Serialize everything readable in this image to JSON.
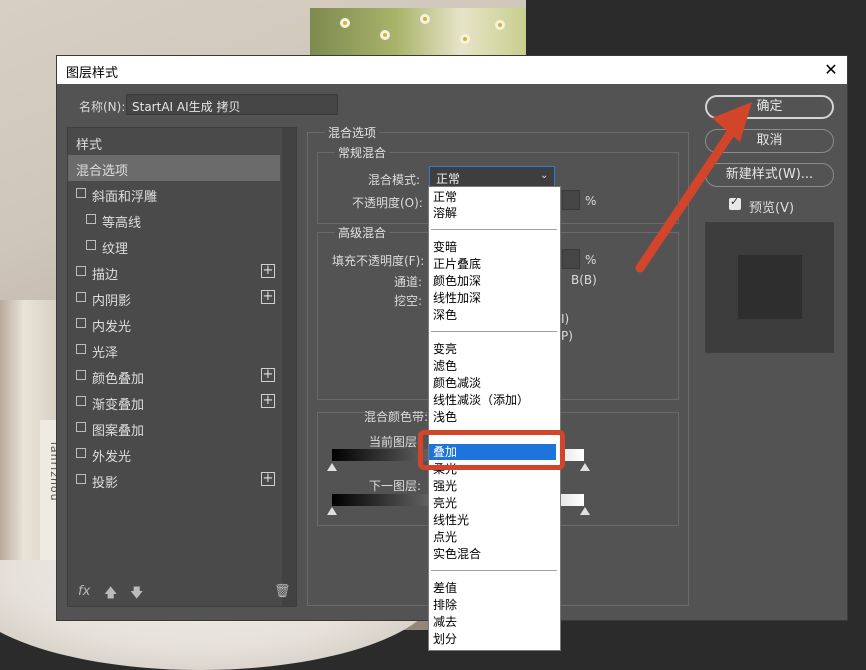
{
  "dialog": {
    "title": "图层样式",
    "name_label": "名称(N):",
    "name_value": "StartAI AI生成 拷贝"
  },
  "left_panel": {
    "header": "样式",
    "items": [
      {
        "label": "混合选项",
        "selected": true
      },
      {
        "label": "斜面和浮雕",
        "checkbox": true
      },
      {
        "label": "等高线",
        "checkbox": true,
        "indent": true
      },
      {
        "label": "纹理",
        "checkbox": true,
        "indent": true
      },
      {
        "label": "描边",
        "checkbox": true,
        "plus": true
      },
      {
        "label": "内阴影",
        "checkbox": true,
        "plus": true
      },
      {
        "label": "内发光",
        "checkbox": true
      },
      {
        "label": "光泽",
        "checkbox": true
      },
      {
        "label": "颜色叠加",
        "checkbox": true,
        "plus": true
      },
      {
        "label": "渐变叠加",
        "checkbox": true,
        "plus": true
      },
      {
        "label": "图案叠加",
        "checkbox": true
      },
      {
        "label": "外发光",
        "checkbox": true
      },
      {
        "label": "投影",
        "checkbox": true,
        "plus": true
      }
    ],
    "footer": {
      "fx": "fx"
    }
  },
  "blend": {
    "section_title": "混合选项",
    "general_title": "常规混合",
    "mode_label": "混合模式:",
    "mode_value": "正常",
    "opacity_label": "不透明度(O):",
    "percent": "%",
    "advanced_title": "高级混合",
    "fill_label": "填充不透明度(F):",
    "channels_label": "通道:",
    "channel_b": "B(B)",
    "knockout_label": "挖空:",
    "partial_i": "I)",
    "partial_p": "P)",
    "blend_if_label": "混合颜色带:",
    "this_layer": "当前图层:",
    "underlying_layer": "下一图层:"
  },
  "dropdown": {
    "groups": [
      [
        "正常",
        "溶解"
      ],
      [
        "变暗",
        "正片叠底",
        "颜色加深",
        "线性加深",
        "深色"
      ],
      [
        "变亮",
        "滤色",
        "颜色减淡",
        "线性减淡（添加）",
        "浅色"
      ],
      [
        "叠加",
        "柔光",
        "强光",
        "亮光",
        "线性光",
        "点光",
        "实色混合"
      ],
      [
        "差值",
        "排除",
        "减去",
        "划分"
      ]
    ],
    "highlighted": "叠加"
  },
  "buttons": {
    "ok": "确定",
    "cancel": "取消",
    "new_style": "新建样式(W)...",
    "preview": "预览(V)"
  },
  "background": {
    "cake_text": "Tanrizhou"
  },
  "colors": {
    "highlight": "#1e74d8",
    "annotation": "#d3452b",
    "dialog_bg": "#535353"
  }
}
